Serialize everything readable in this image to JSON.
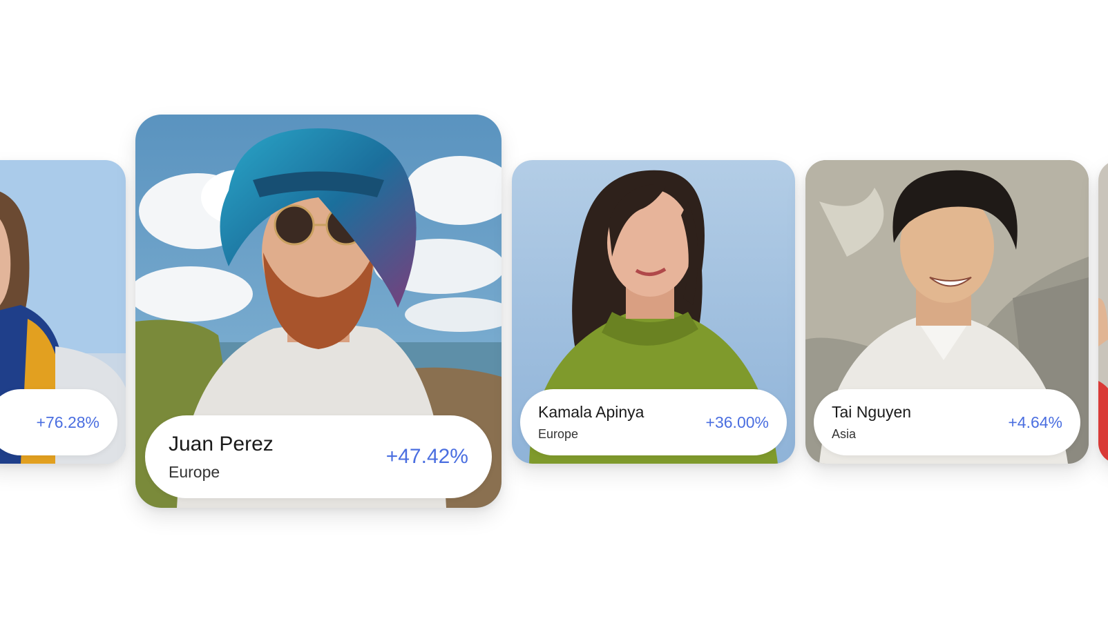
{
  "cards": [
    {
      "name": "",
      "region": "",
      "change": "+76.28%"
    },
    {
      "name": "Juan Perez",
      "region": "Europe",
      "change": "+47.42%"
    },
    {
      "name": "Kamala Apinya",
      "region": "Europe",
      "change": "+36.00%"
    },
    {
      "name": "Tai Nguyen",
      "region": "Asia",
      "change": "+4.64%"
    }
  ],
  "colors": {
    "accent": "#4a6ee0",
    "sky": "#a9c8e6",
    "text": "#1a1a1a"
  }
}
